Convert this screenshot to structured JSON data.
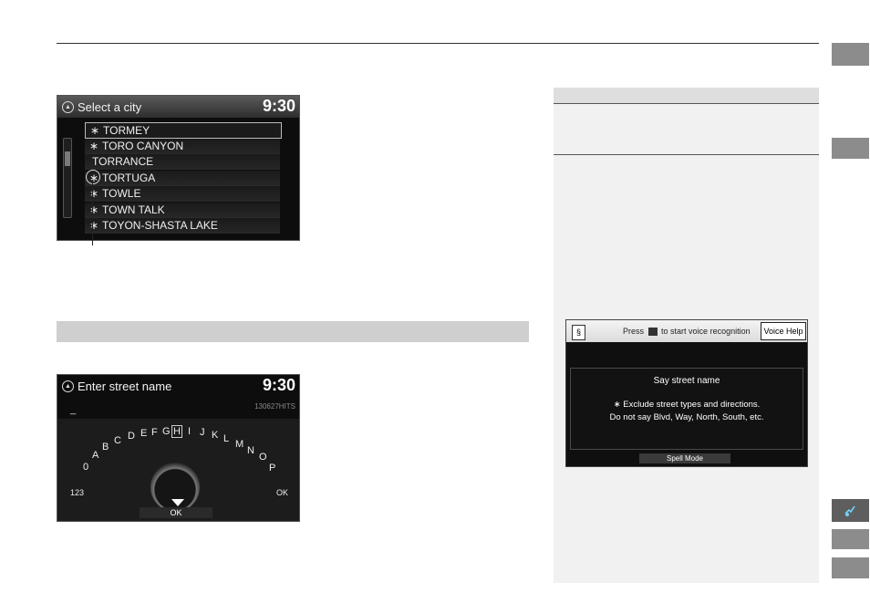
{
  "screen_city": {
    "title": "Select a city",
    "clock": "9:30",
    "cities": [
      {
        "label": "TORMEY",
        "star": "∗"
      },
      {
        "label": "TORO CANYON",
        "star": "∗"
      },
      {
        "label": "TORRANCE",
        "star": ""
      },
      {
        "label": "TORTUGA",
        "star": "∗"
      },
      {
        "label": "TOWLE",
        "star": "∗"
      },
      {
        "label": "TOWN TALK",
        "star": "∗"
      },
      {
        "label": "TOYON-SHASTA LAKE",
        "star": "∗"
      }
    ]
  },
  "screen_street": {
    "title": "Enter street name",
    "clock": "9:30",
    "hits": "130627HITS",
    "entry_cursor": "_",
    "letters": [
      "0",
      "A",
      "B",
      "C",
      "D",
      "E",
      "F",
      "G",
      "H",
      "I",
      "J",
      "K",
      "L",
      "M",
      "N",
      "O",
      "P"
    ],
    "highlighted_letter": "H",
    "left_key": "123",
    "right_key": "OK",
    "ok_label": "OK"
  },
  "screen_voice": {
    "press_prefix": "Press",
    "press_suffix": "to start voice recognition",
    "voice_help": "Voice Help",
    "say": "Say street name",
    "note_line1": "∗ Exclude street types and directions.",
    "note_line2": "Do not say Blvd, Way, North, South, etc.",
    "spell_mode": "Spell Mode"
  },
  "icons": [
    "nav-icon",
    "voice-icon",
    "star-icon"
  ]
}
